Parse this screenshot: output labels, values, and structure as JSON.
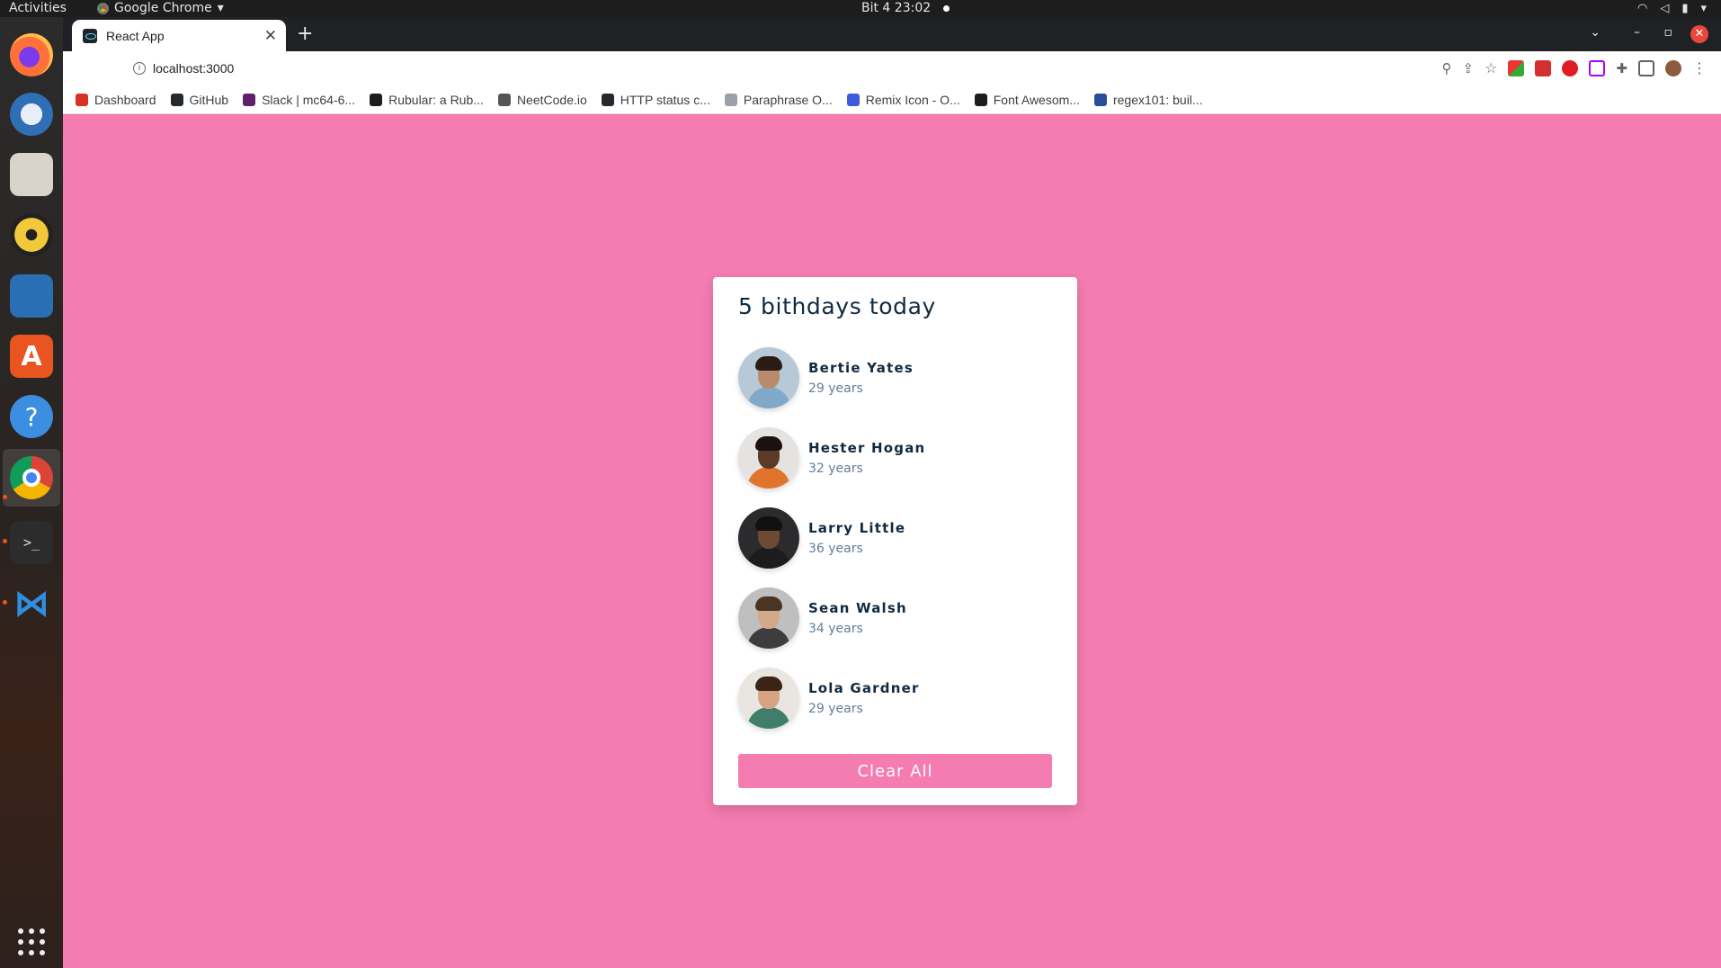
{
  "system": {
    "activities": "Activities",
    "app_menu": "Google Chrome",
    "clock": "Bit 4  23:02"
  },
  "browser": {
    "tab_title": "React App",
    "url": "localhost:3000",
    "bookmarks": [
      {
        "label": "Dashboard",
        "color": "#d93025"
      },
      {
        "label": "GitHub",
        "color": "#24292e"
      },
      {
        "label": "Slack | mc64-6...",
        "color": "#611f69"
      },
      {
        "label": "Rubular: a Rub...",
        "color": "#1d1d1d"
      },
      {
        "label": "NeetCode.io",
        "color": "#555555"
      },
      {
        "label": "HTTP status c...",
        "color": "#24292e"
      },
      {
        "label": "Paraphrase O...",
        "color": "#9aa0a6"
      },
      {
        "label": "Remix Icon - O...",
        "color": "#3b5bdb"
      },
      {
        "label": "Font Awesom...",
        "color": "#1d1d1d"
      },
      {
        "label": "regex101: buil...",
        "color": "#2a4d9b"
      }
    ]
  },
  "app": {
    "heading": "5 bithdays today",
    "people": [
      {
        "name": "Bertie Yates",
        "age": "29 years",
        "skin": "#b98b6b",
        "hair": "#2a1b14",
        "shirt": "#7fa8c9",
        "bg": "#b7c9d6"
      },
      {
        "name": "Hester Hogan",
        "age": "32 years",
        "skin": "#5b3a27",
        "hair": "#1a120e",
        "shirt": "#e0742c",
        "bg": "#e5e3e1"
      },
      {
        "name": "Larry Little",
        "age": "36 years",
        "skin": "#6d4a34",
        "hair": "#111111",
        "shirt": "#1c1c1f",
        "bg": "#2b2b2e"
      },
      {
        "name": "Sean Walsh",
        "age": "34 years",
        "skin": "#d2a98a",
        "hair": "#4a3424",
        "shirt": "#3d3d3d",
        "bg": "#bfbfbf"
      },
      {
        "name": "Lola Gardner",
        "age": "29 years",
        "skin": "#d6a383",
        "hair": "#3b2416",
        "shirt": "#3f7f6a",
        "bg": "#e9e6e2"
      }
    ],
    "clear_label": "Clear All",
    "colors": {
      "page_bg": "#f47cb1",
      "title": "#102a42",
      "subtitle": "#617d98",
      "button": "#f47cb1"
    }
  }
}
